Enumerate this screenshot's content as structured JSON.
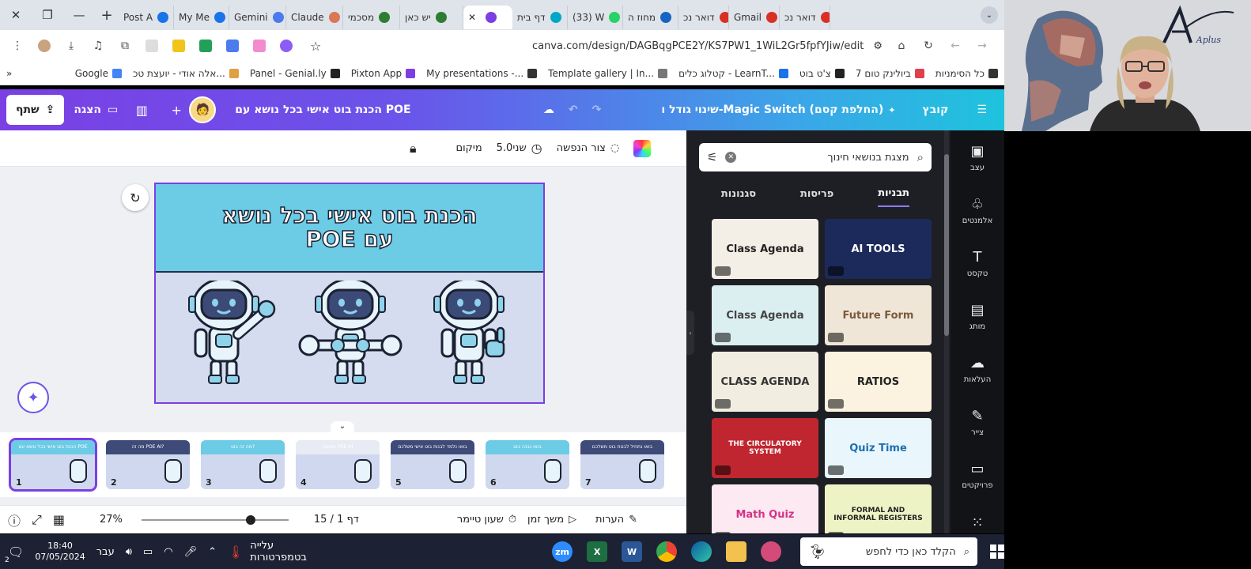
{
  "browser": {
    "tabs": [
      {
        "label": "Post A",
        "color": "#1a73e8"
      },
      {
        "label": "My Me",
        "color": "#1a73e8"
      },
      {
        "label": "Gemini",
        "color": "#4b7bec"
      },
      {
        "label": "Claude",
        "color": "#d97757"
      },
      {
        "label": "מסכמי",
        "color": "#2e7d32"
      },
      {
        "label": "יש כאן",
        "color": "#2e7d32"
      },
      {
        "label": "",
        "color": "#7b3fe4",
        "active": true
      },
      {
        "label": "דף בית",
        "color": "#00a8c8"
      },
      {
        "label": "(33) W",
        "color": "#25d366"
      },
      {
        "label": "מחוז ה",
        "color": "#1565c0"
      },
      {
        "label": "דואר נכ",
        "color": "#d93025"
      },
      {
        "label": "Gmail",
        "color": "#d93025"
      },
      {
        "label": "דואר נכ",
        "color": "#d93025"
      }
    ],
    "url": "canva.com/design/DAGBqgPCE2Y/KS7PW1_1WiL2Gr5fpfYJiw/edit",
    "bookmarks": [
      {
        "label": "Google",
        "color": "#4285f4"
      },
      {
        "label": "אלה אודי - יועצת טכ...",
        "color": "#e0a040"
      },
      {
        "label": "Panel - Genial.ly",
        "color": "#222"
      },
      {
        "label": "Pixton App",
        "color": "#7b3fe4"
      },
      {
        "label": "My presentations -...",
        "color": "#333"
      },
      {
        "label": "Template gallery | In...",
        "color": "#777"
      },
      {
        "label": "קטלוג כלים - LearnT...",
        "color": "#1a73e8"
      },
      {
        "label": "צ'ט בוט",
        "color": "#222"
      },
      {
        "label": "ביולינק טום 7",
        "color": "#e0404a"
      },
      {
        "label": "כל הסימניות",
        "color": "#333"
      }
    ]
  },
  "canva": {
    "share_label": "שתף",
    "present_label": "הצגה",
    "doc_title": "הכנת בוט אישי בכל נושא עם POE",
    "magic_switch": "שינוי גודל ו-Magic Switch (החלפת קסם)",
    "file_label": "קובץ",
    "toolbar": {
      "position_label": "מיקום",
      "duration_label": "5.0שני",
      "transition_label": "צור הנפשה"
    },
    "slide": {
      "title_line1": "הכנת בוט אישי בכל נושא",
      "title_line2": "עם POE"
    },
    "thumbnails": [
      {
        "num": "1",
        "title": "הכנת בוט אישי בכל נושא עם POE",
        "bg": "#6ccbe5"
      },
      {
        "num": "2",
        "title": "מה זה POE AI?",
        "bg": "#3e4a78"
      },
      {
        "num": "3",
        "title": "מה זה בוט?",
        "bg": "#6ccbe5"
      },
      {
        "num": "4",
        "title": "ממשק POE AI",
        "bg": "#e8ebf3"
      },
      {
        "num": "5",
        "title": "בואו נלמד לבנות בוט אישי משלכם",
        "bg": "#3e4a78"
      },
      {
        "num": "6",
        "title": "בואו נבנה בוט",
        "bg": "#6ccbe5"
      },
      {
        "num": "7",
        "title": "בואו נתחיל לבנות בוט משלכם",
        "bg": "#3e4a78"
      }
    ],
    "bottom": {
      "notes_label": "הערות",
      "timer_label": "משך זמן",
      "stopwatch_label": "שעון טיימר",
      "page_label": "דף 1 / 15",
      "zoom_label": "27%"
    },
    "panel": {
      "search_query": "מצגת בנושאי חינוך",
      "tabs": [
        "תבניות",
        "פריסות",
        "סגנונות"
      ],
      "active_tab": "תבניות",
      "templates": [
        {
          "label": "Class Agenda",
          "bg": "#f4efe6",
          "fg": "#222"
        },
        {
          "label": "AI TOOLS",
          "bg": "#1b2a5a",
          "fg": "#fff"
        },
        {
          "label": "Class Agenda",
          "bg": "#dbeef0",
          "fg": "#444"
        },
        {
          "label": "Future Form",
          "bg": "#efe6d8",
          "fg": "#7a5a3a"
        },
        {
          "label": "CLASS AGENDA",
          "bg": "#f1ede0",
          "fg": "#333"
        },
        {
          "label": "RATIOS",
          "bg": "#fbf3df",
          "fg": "#222"
        },
        {
          "label": "THE CIRCULATORY SYSTEM",
          "bg": "#c0262f",
          "fg": "#fff"
        },
        {
          "label": "Quiz Time",
          "bg": "#e9f6fb",
          "fg": "#1f6fb0"
        },
        {
          "label": "Math Quiz",
          "bg": "#fde9f2",
          "fg": "#d63384"
        },
        {
          "label": "FORMAL AND INFORMAL REGISTERS",
          "bg": "#eef3c6",
          "fg": "#222"
        }
      ]
    },
    "rail": [
      {
        "label": "עצב",
        "icon": "design-icon"
      },
      {
        "label": "אלמנטים",
        "icon": "elements-icon"
      },
      {
        "label": "טקסט",
        "icon": "text-icon"
      },
      {
        "label": "מותג",
        "icon": "brand-icon"
      },
      {
        "label": "העלאות",
        "icon": "upload-icon"
      },
      {
        "label": "צייר",
        "icon": "draw-icon"
      },
      {
        "label": "פרויקטים",
        "icon": "projects-icon"
      }
    ]
  },
  "taskbar": {
    "time": "18:40",
    "date": "07/05/2024",
    "lang": "עבר",
    "weather": "עלייה בטמפרטורות",
    "search_placeholder": "הקלד כאן כדי לחפש",
    "notif_count": "2"
  },
  "cam": {
    "logo_text": "Aplus"
  }
}
